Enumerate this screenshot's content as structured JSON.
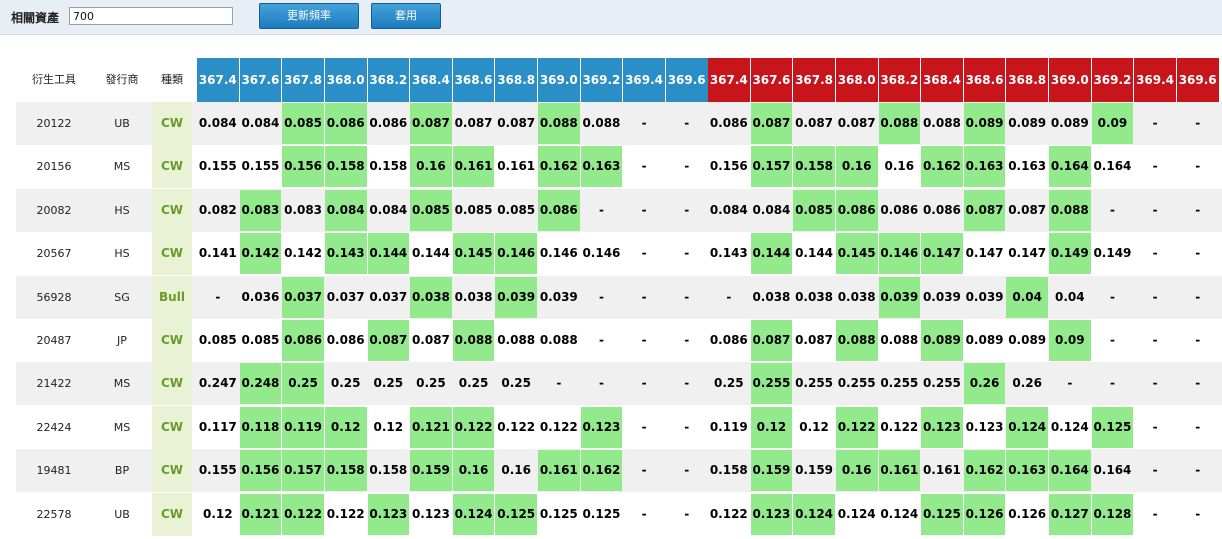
{
  "toolbar": {
    "asset_label": "相關資產",
    "asset_value": "700",
    "update_label": "更新頻率",
    "apply_label": "套用"
  },
  "table": {
    "headers": {
      "instrument": "衍生工具",
      "issuer": "發行商",
      "type": "種類"
    },
    "blue_prices": [
      "367.4",
      "367.6",
      "367.8",
      "368.0",
      "368.2",
      "368.4",
      "368.6",
      "368.8",
      "369.0",
      "369.2",
      "369.4",
      "369.6"
    ],
    "red_prices": [
      "367.4",
      "367.6",
      "367.8",
      "368.0",
      "368.2",
      "368.4",
      "368.6",
      "368.8",
      "369.0",
      "369.2",
      "369.4",
      "369.6"
    ],
    "rows": [
      {
        "code": "20122",
        "issuer": "UB",
        "type": "CW",
        "blue": [
          "0.084",
          "0.084",
          "0.085",
          "0.086",
          "0.086",
          "0.087",
          "0.087",
          "0.087",
          "0.088",
          "0.088",
          "-",
          "-"
        ],
        "red": [
          "0.086",
          "0.087",
          "0.087",
          "0.087",
          "0.088",
          "0.088",
          "0.089",
          "0.089",
          "0.089",
          "0.09",
          "-",
          "-"
        ]
      },
      {
        "code": "20156",
        "issuer": "MS",
        "type": "CW",
        "blue": [
          "0.155",
          "0.155",
          "0.156",
          "0.158",
          "0.158",
          "0.16",
          "0.161",
          "0.161",
          "0.162",
          "0.163",
          "-",
          "-"
        ],
        "red": [
          "0.156",
          "0.157",
          "0.158",
          "0.16",
          "0.16",
          "0.162",
          "0.163",
          "0.163",
          "0.164",
          "0.164",
          "-",
          "-"
        ]
      },
      {
        "code": "20082",
        "issuer": "HS",
        "type": "CW",
        "blue": [
          "0.082",
          "0.083",
          "0.083",
          "0.084",
          "0.084",
          "0.085",
          "0.085",
          "0.085",
          "0.086",
          "-",
          "-",
          "-"
        ],
        "red": [
          "0.084",
          "0.084",
          "0.085",
          "0.086",
          "0.086",
          "0.086",
          "0.087",
          "0.087",
          "0.088",
          "-",
          "-",
          "-"
        ]
      },
      {
        "code": "20567",
        "issuer": "HS",
        "type": "CW",
        "blue": [
          "0.141",
          "0.142",
          "0.142",
          "0.143",
          "0.144",
          "0.144",
          "0.145",
          "0.146",
          "0.146",
          "0.146",
          "-",
          "-"
        ],
        "red": [
          "0.143",
          "0.144",
          "0.144",
          "0.145",
          "0.146",
          "0.147",
          "0.147",
          "0.147",
          "0.149",
          "0.149",
          "-",
          "-"
        ]
      },
      {
        "code": "56928",
        "issuer": "SG",
        "type": "Bull",
        "blue": [
          "-",
          "0.036",
          "0.037",
          "0.037",
          "0.037",
          "0.038",
          "0.038",
          "0.039",
          "0.039",
          "-",
          "-",
          "-"
        ],
        "red": [
          "-",
          "0.038",
          "0.038",
          "0.038",
          "0.039",
          "0.039",
          "0.039",
          "0.04",
          "0.04",
          "-",
          "-",
          "-"
        ]
      },
      {
        "code": "20487",
        "issuer": "JP",
        "type": "CW",
        "blue": [
          "0.085",
          "0.085",
          "0.086",
          "0.086",
          "0.087",
          "0.087",
          "0.088",
          "0.088",
          "0.088",
          "-",
          "-",
          "-"
        ],
        "red": [
          "0.086",
          "0.087",
          "0.087",
          "0.088",
          "0.088",
          "0.089",
          "0.089",
          "0.089",
          "0.09",
          "-",
          "-",
          "-"
        ]
      },
      {
        "code": "21422",
        "issuer": "MS",
        "type": "CW",
        "blue": [
          "0.247",
          "0.248",
          "0.25",
          "0.25",
          "0.25",
          "0.25",
          "0.25",
          "0.25",
          "-",
          "-",
          "-",
          "-"
        ],
        "red": [
          "0.25",
          "0.255",
          "0.255",
          "0.255",
          "0.255",
          "0.255",
          "0.26",
          "0.26",
          "-",
          "-",
          "-",
          "-"
        ]
      },
      {
        "code": "22424",
        "issuer": "MS",
        "type": "CW",
        "blue": [
          "0.117",
          "0.118",
          "0.119",
          "0.12",
          "0.12",
          "0.121",
          "0.122",
          "0.122",
          "0.122",
          "0.123",
          "-",
          "-"
        ],
        "red": [
          "0.119",
          "0.12",
          "0.12",
          "0.122",
          "0.122",
          "0.123",
          "0.123",
          "0.124",
          "0.124",
          "0.125",
          "-",
          "-"
        ]
      },
      {
        "code": "19481",
        "issuer": "BP",
        "type": "CW",
        "blue": [
          "0.155",
          "0.156",
          "0.157",
          "0.158",
          "0.158",
          "0.159",
          "0.16",
          "0.16",
          "0.161",
          "0.162",
          "-",
          "-"
        ],
        "red": [
          "0.158",
          "0.159",
          "0.159",
          "0.16",
          "0.161",
          "0.161",
          "0.162",
          "0.163",
          "0.164",
          "0.164",
          "-",
          "-"
        ]
      },
      {
        "code": "22578",
        "issuer": "UB",
        "type": "CW",
        "blue": [
          "0.12",
          "0.121",
          "0.122",
          "0.122",
          "0.123",
          "0.123",
          "0.124",
          "0.125",
          "0.125",
          "0.125",
          "-",
          "-"
        ],
        "red": [
          "0.122",
          "0.123",
          "0.124",
          "0.124",
          "0.124",
          "0.125",
          "0.126",
          "0.126",
          "0.127",
          "0.128",
          "-",
          "-"
        ]
      }
    ]
  },
  "colors": {
    "blue_header": "#2a8fc6",
    "red_header": "#c8141b",
    "highlight_green": "#92ea8c",
    "type_cell_bg": "#e9f2d4",
    "type_text": "#6a9a2a",
    "row_shade": "#f0f0f0"
  }
}
